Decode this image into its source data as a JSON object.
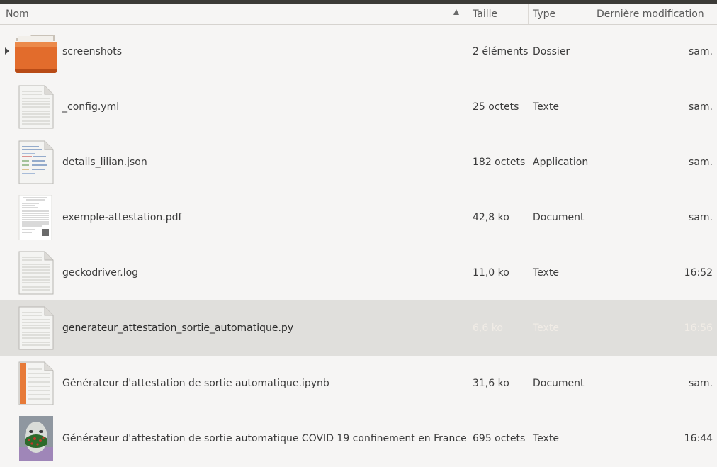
{
  "columns": {
    "name": "Nom",
    "size": "Taille",
    "type": "Type",
    "modified": "Dernière modification"
  },
  "files": [
    {
      "name": "screenshots",
      "size": "2 éléments",
      "type": "Dossier",
      "modified": "sam.",
      "icon": "folder-icon"
    },
    {
      "name": "_config.yml",
      "size": "25 octets",
      "type": "Texte",
      "modified": "sam.",
      "icon": "text-file-icon"
    },
    {
      "name": "details_lilian.json",
      "size": "182 octets",
      "type": "Application",
      "modified": "sam.",
      "icon": "json-file-icon"
    },
    {
      "name": "exemple-attestation.pdf",
      "size": "42,8 ko",
      "type": "Document",
      "modified": "sam.",
      "icon": "pdf-file-icon"
    },
    {
      "name": "geckodriver.log",
      "size": "11,0 ko",
      "type": "Texte",
      "modified": "16:52",
      "icon": "text-file-icon"
    },
    {
      "name": "generateur_attestation_sortie_automatique.py",
      "size": "6,6 ko",
      "type": "Texte",
      "modified": "16:56",
      "icon": "text-file-icon",
      "selected": true
    },
    {
      "name": "Générateur d'attestation de sortie automatique.ipynb",
      "size": "31,6 ko",
      "type": "Document",
      "modified": "sam.",
      "icon": "notebook-file-icon"
    },
    {
      "name": "Générateur d'attestation de sortie automatique COVID 19 confinement en France",
      "size": "695 octets",
      "type": "Texte",
      "modified": "16:44",
      "icon": "image-thumbnail-icon"
    }
  ]
}
